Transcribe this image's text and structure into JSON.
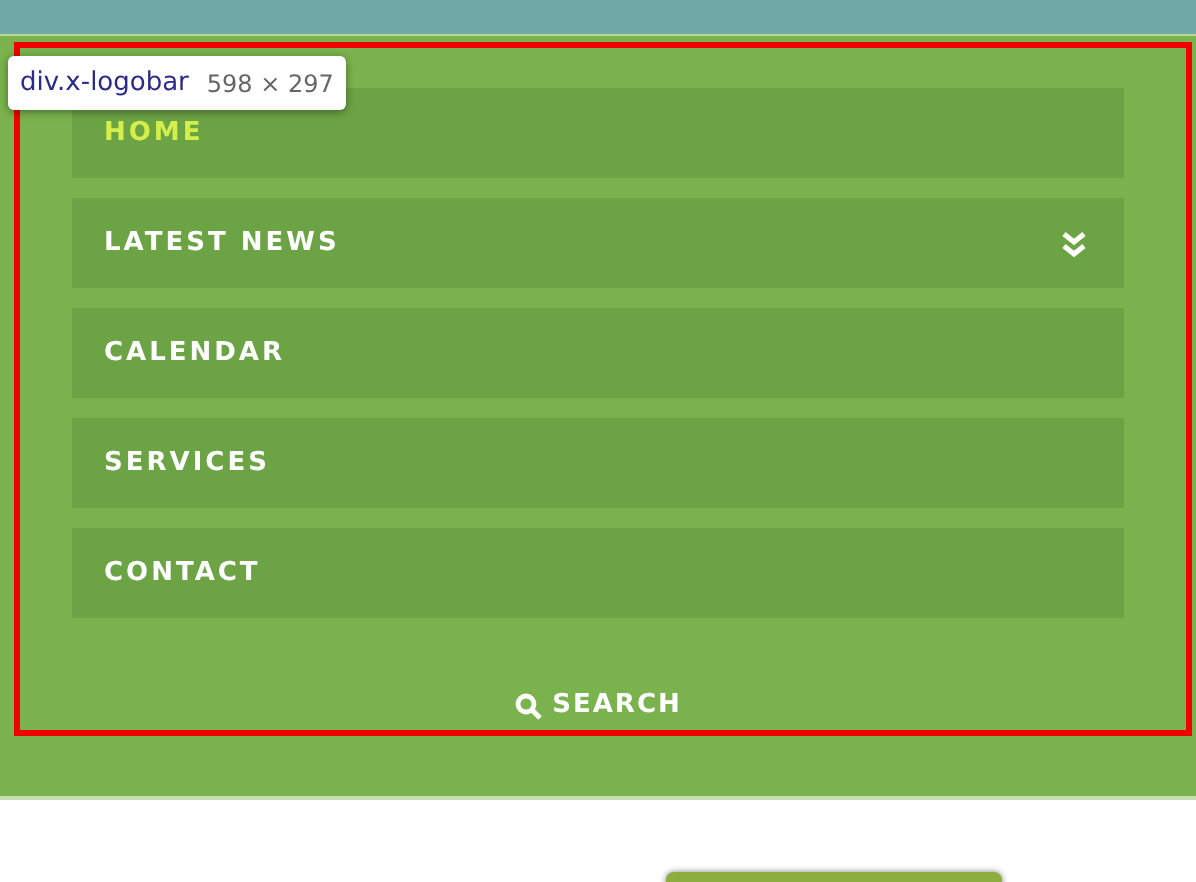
{
  "menu": [
    {
      "label": "HOME",
      "selected": true,
      "expandable": false
    },
    {
      "label": "LATEST NEWS",
      "selected": false,
      "expandable": true
    },
    {
      "label": "CALENDAR",
      "selected": false,
      "expandable": false
    },
    {
      "label": "SERVICES",
      "selected": false,
      "expandable": false
    },
    {
      "label": "CONTACT",
      "selected": false,
      "expandable": false
    }
  ],
  "search": {
    "label": "SEARCH"
  },
  "inspector_tooltip": {
    "selector": "div.x-logobar",
    "size": "598 × 297"
  }
}
